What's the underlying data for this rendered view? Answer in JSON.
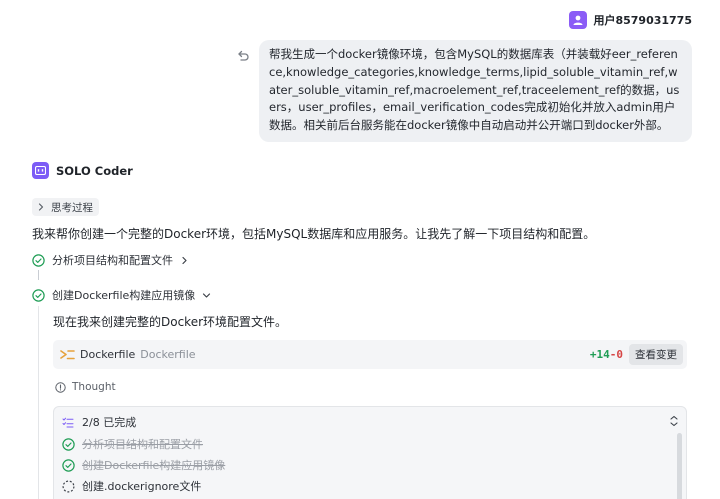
{
  "user": {
    "name": "用户8579031775"
  },
  "request": {
    "text": "帮我生成一个docker镜像环境，包含MySQL的数据库表（并装载好eer_reference,knowledge_categories,knowledge_terms,lipid_soluble_vitamin_ref,water_soluble_vitamin_ref,macroelement_ref,traceelement_ref的数据，users，user_profiles，email_verification_codes完成初始化并放入admin用户数据。相关前后台服务能在docker镜像中自动启动并公开端口到docker外部。"
  },
  "agent": {
    "name": "SOLO Coder",
    "thinking_label": "思考过程",
    "intro": "我来帮你创建一个完整的Docker环境，包括MySQL数据库和应用服务。让我先了解一下项目结构和配置。",
    "steps": [
      {
        "label": "分析项目结构和配置文件",
        "status": "done"
      },
      {
        "label": "创建Dockerfile构建应用镜像",
        "status": "done"
      }
    ],
    "message": "现在我来创建完整的Docker环境配置文件。",
    "file": {
      "name": "Dockerfile",
      "path": "Dockerfile",
      "additions": "+14",
      "deletions": "-0",
      "view_label": "查看变更"
    },
    "thought_label": "Thought",
    "todo": {
      "progress": "2/8 已完成",
      "items": [
        {
          "label": "分析项目结构和配置文件",
          "status": "done"
        },
        {
          "label": "创建Dockerfile构建应用镜像",
          "status": "done"
        },
        {
          "label": "创建.dockerignore文件",
          "status": "in-progress"
        }
      ]
    }
  },
  "colors": {
    "accent": "#8b5cf6",
    "success": "#1f9d55",
    "danger": "#d64545"
  }
}
